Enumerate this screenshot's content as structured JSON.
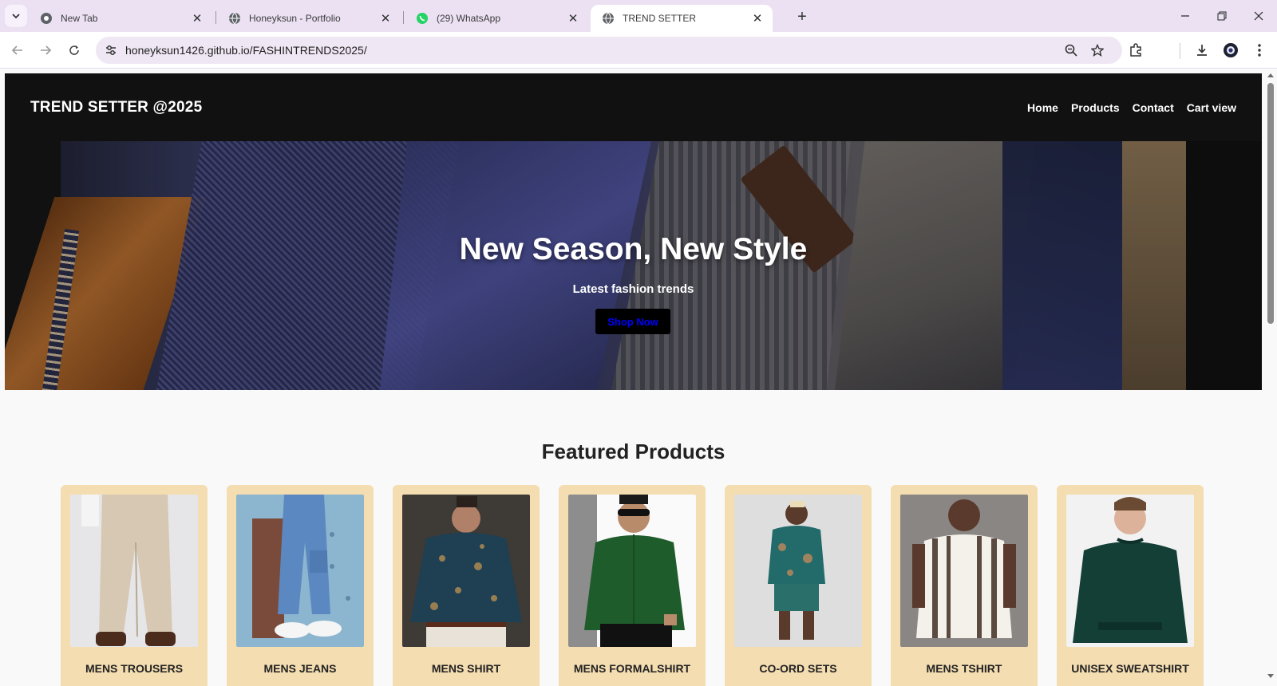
{
  "browser": {
    "tabs": [
      {
        "title": "New Tab",
        "icon": "chrome-icon",
        "active": false
      },
      {
        "title": "Honeyksun - Portfolio",
        "icon": "globe-icon",
        "active": false
      },
      {
        "title": "(29) WhatsApp",
        "icon": "whatsapp-icon",
        "active": false
      },
      {
        "title": "TREND SETTER",
        "icon": "globe-icon",
        "active": true
      }
    ],
    "url": "honeyksun1426.github.io/FASHINTRENDS2025/"
  },
  "site": {
    "brand": "TREND SETTER @2025",
    "nav": [
      "Home",
      "Products",
      "Contact",
      "Cart view"
    ],
    "hero": {
      "title": "New Season, New Style",
      "subtitle": "Latest fashion trends",
      "cta": "Shop Now"
    },
    "featured_title": "Featured Products",
    "products": [
      {
        "name": "MENS TROUSERS",
        "image": "trousers"
      },
      {
        "name": "MENS JEANS",
        "image": "jeans"
      },
      {
        "name": "MENS SHIRT",
        "image": "printed-shirt"
      },
      {
        "name": "MENS FORMALSHIRT",
        "image": "formal-shirt"
      },
      {
        "name": "CO-ORD SETS",
        "image": "coord-set"
      },
      {
        "name": "MENS TSHIRT",
        "image": "striped-tshirt"
      },
      {
        "name": "UNISEX SWEATSHIRT",
        "image": "sweatshirt"
      }
    ]
  },
  "colors": {
    "header_bg": "#111111",
    "card_bg": "#f4ddb1",
    "cta_text": "#0000ff",
    "tabstrip_bg": "#ebe1f3"
  }
}
